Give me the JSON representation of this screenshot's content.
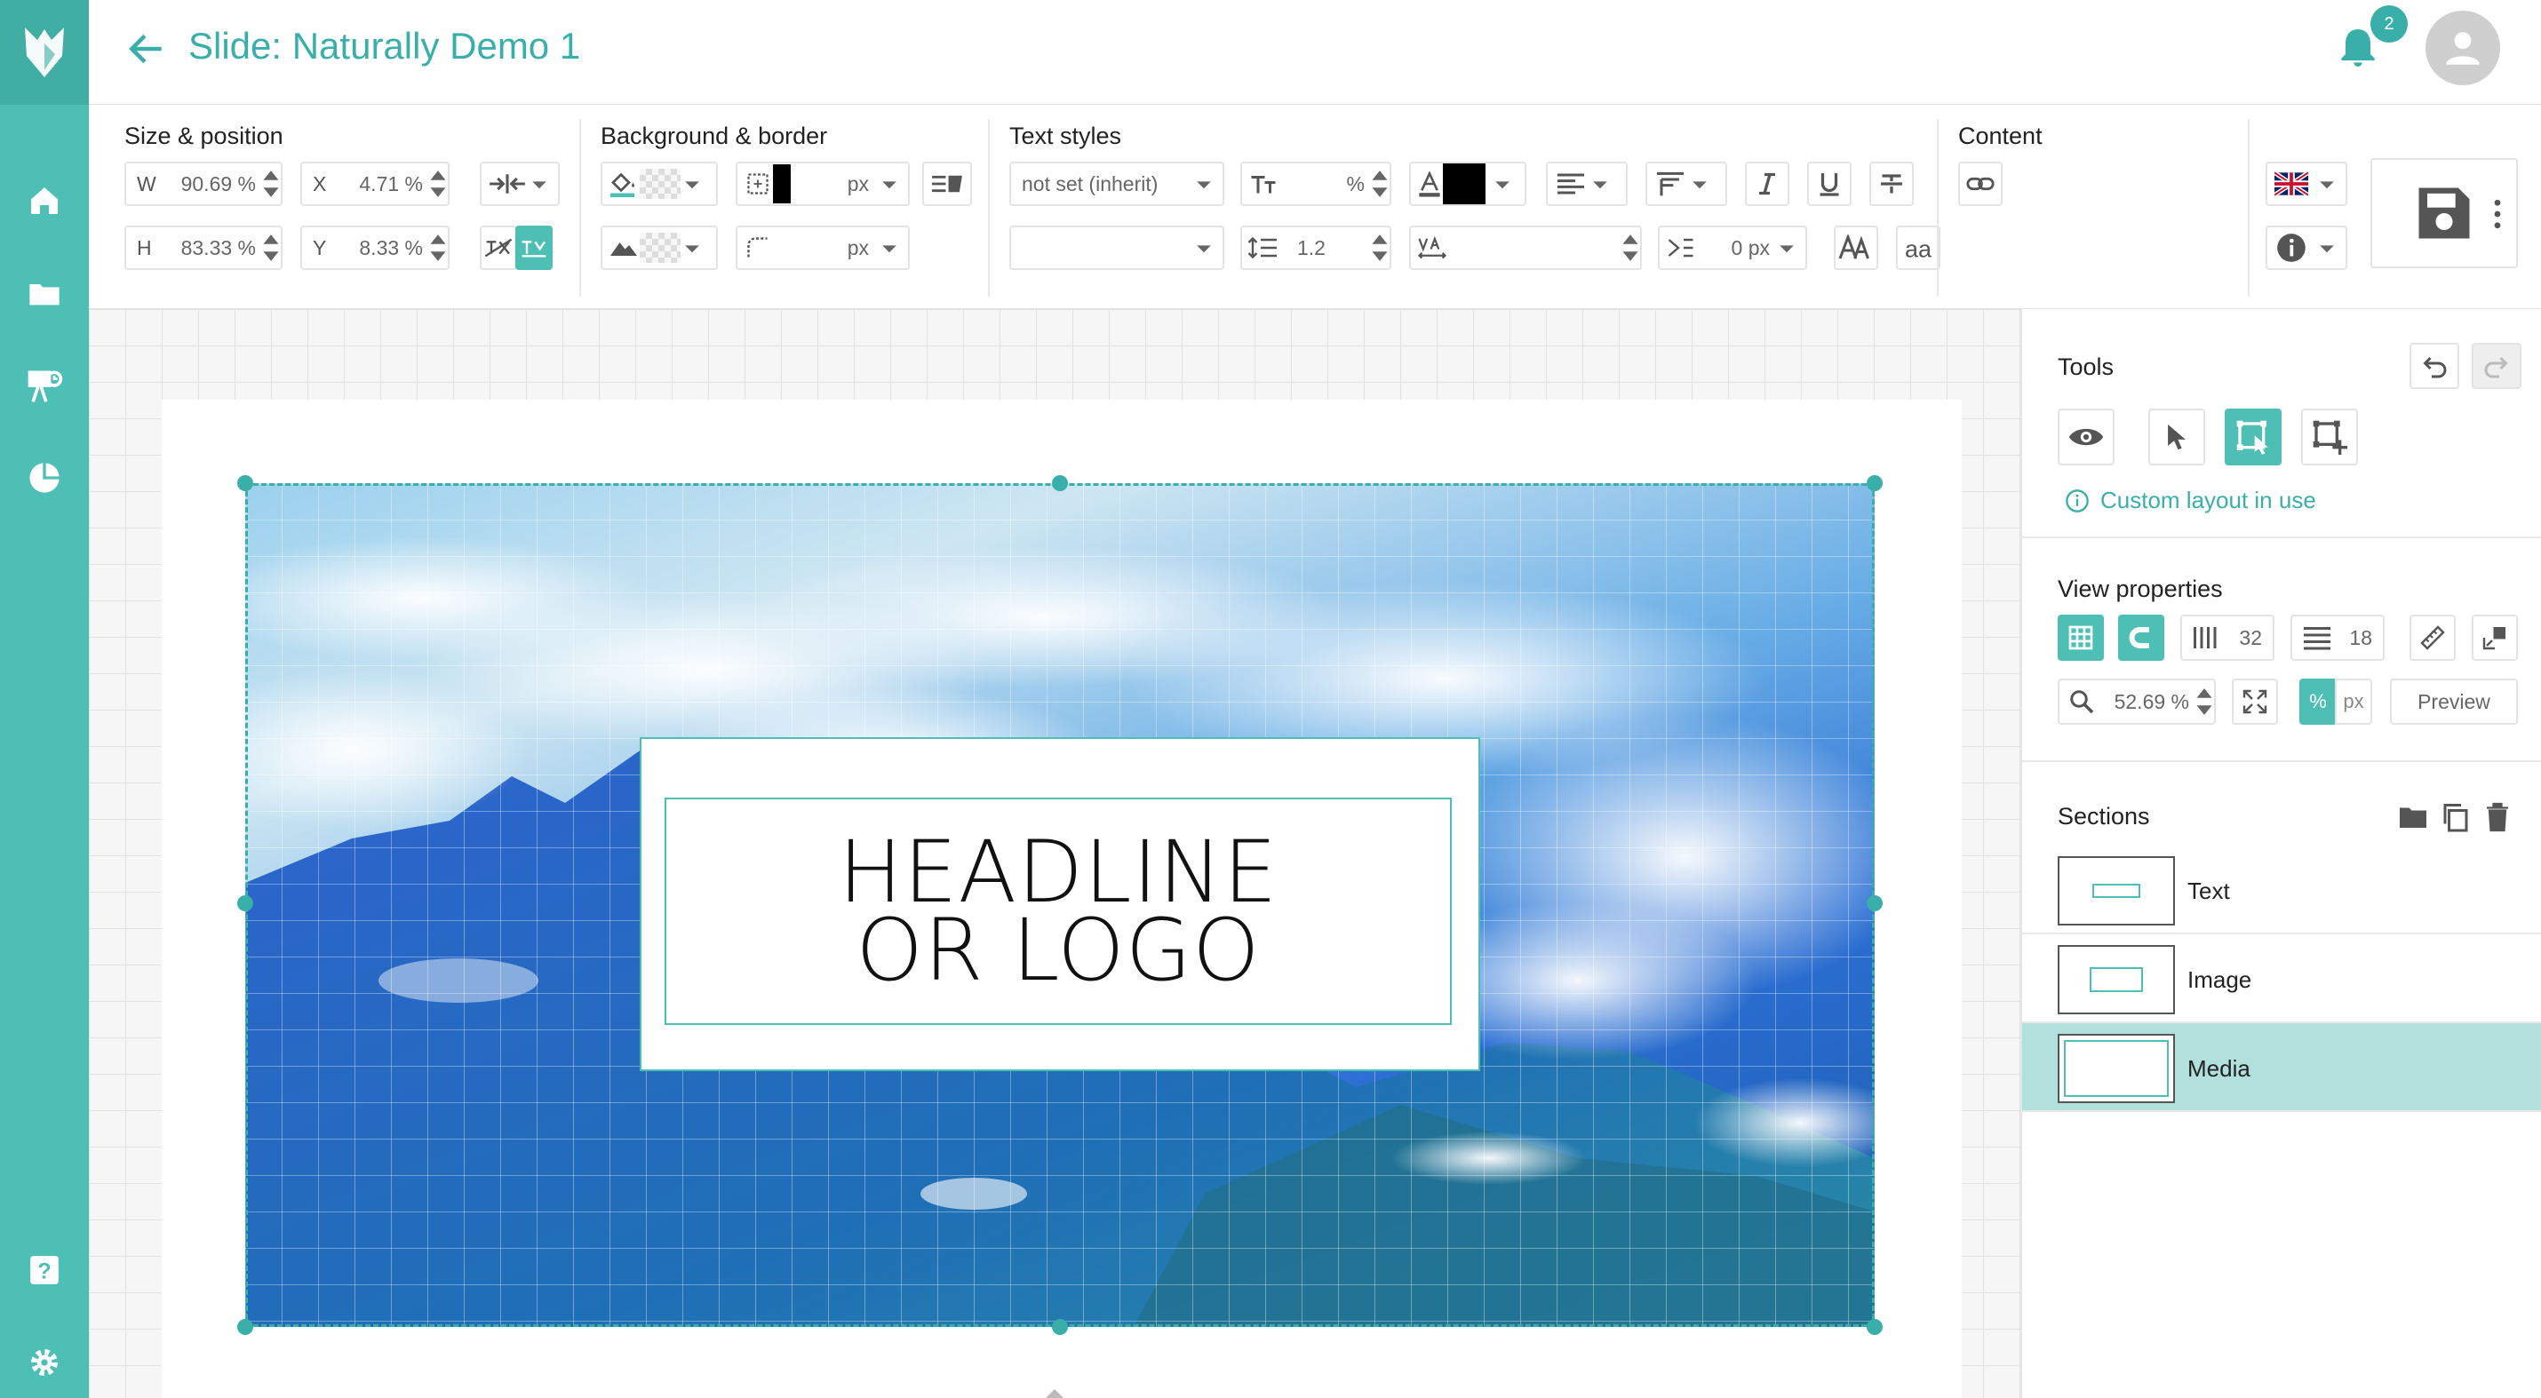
{
  "header": {
    "title": "Slide: Naturally Demo 1",
    "notification_count": "2"
  },
  "toolbar": {
    "size_position": {
      "title": "Size & position",
      "w_label": "W",
      "w_value": "90.69 %",
      "x_label": "X",
      "x_value": "4.71 %",
      "h_label": "H",
      "h_value": "83.33 %",
      "y_label": "Y",
      "y_value": "8.33 %"
    },
    "background_border": {
      "title": "Background & border",
      "border_width_unit": "px",
      "radius_unit": "px",
      "border_color": "#000000"
    },
    "text_styles": {
      "title": "Text styles",
      "font_family": "not set (inherit)",
      "font_weight": "",
      "font_size_unit": "%",
      "text_color": "#000000",
      "line_height": "1.2",
      "letter_spacing": "0 px"
    },
    "content": {
      "title": "Content"
    },
    "language_flag": "uk-flag-icon"
  },
  "slide": {
    "headline_line1": "HEADLINE",
    "headline_line2": "OR LOGO"
  },
  "right_panel": {
    "tools": {
      "title": "Tools",
      "custom_layout_text": "Custom layout in use"
    },
    "view_properties": {
      "title": "View properties",
      "columns": "32",
      "rows": "18",
      "zoom": "52.69 %",
      "unit_percent": "%",
      "unit_px": "px",
      "preview_label": "Preview"
    },
    "sections": {
      "title": "Sections",
      "items": [
        {
          "label": "Text"
        },
        {
          "label": "Image"
        },
        {
          "label": "Media"
        }
      ],
      "active": "Media"
    }
  },
  "colors": {
    "accent": "#3aafa9",
    "sidebar": "#4dbfb4",
    "active_row": "#b2e0dc"
  }
}
